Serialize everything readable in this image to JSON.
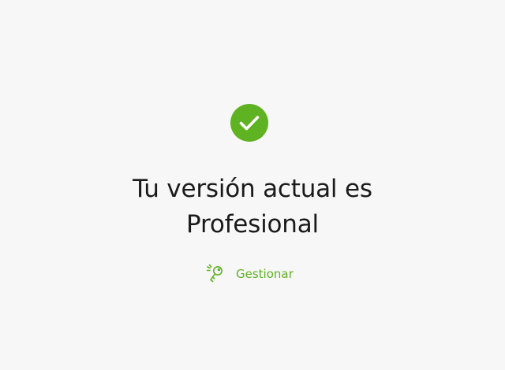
{
  "colors": {
    "background": "#f7f7f7",
    "accent": "#5fb221",
    "text": "#1a1a1a"
  },
  "status": {
    "icon": "checkmark-circle-icon"
  },
  "heading": {
    "line1": "Tu versión actual es",
    "line2": "Profesional"
  },
  "manage": {
    "icon": "key-icon",
    "label": "Gestionar"
  }
}
